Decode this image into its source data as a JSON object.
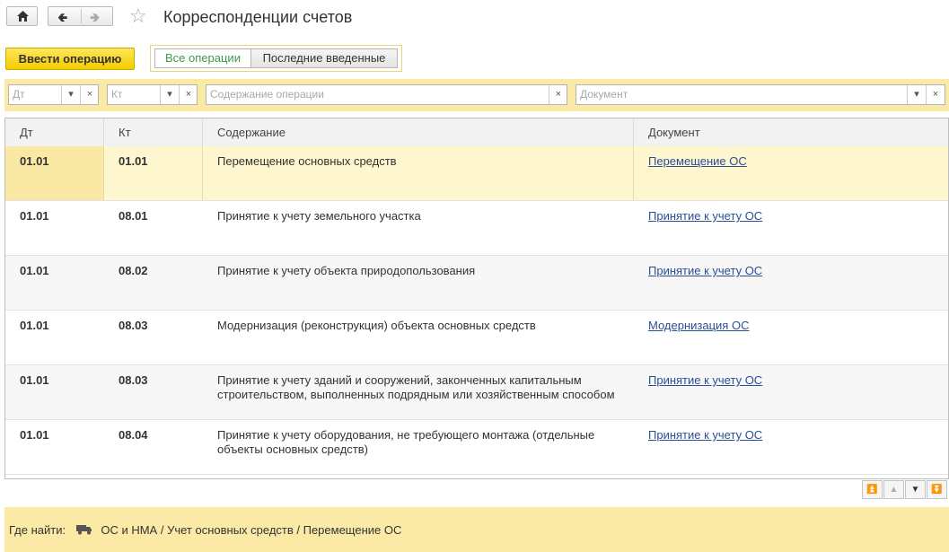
{
  "title": "Корреспонденции счетов",
  "actions": {
    "enter_operation": "Ввести операцию",
    "toggle_all": "Все операции",
    "toggle_recent": "Последние введенные"
  },
  "filters": {
    "dt_placeholder": "Дт",
    "kt_placeholder": "Кт",
    "content_placeholder": "Содержание операции",
    "document_placeholder": "Документ"
  },
  "table": {
    "headers": [
      "Дт",
      "Кт",
      "Содержание",
      "Документ"
    ],
    "rows": [
      {
        "dt": "01.01",
        "kt": "01.01",
        "content": "Перемещение основных средств",
        "content2": "",
        "document": "Перемещение ОС"
      },
      {
        "dt": "01.01",
        "kt": "08.01",
        "content": "Принятие к учету земельного участка",
        "content2": "",
        "document": "Принятие к учету ОС"
      },
      {
        "dt": "01.01",
        "kt": "08.02",
        "content": "Принятие к учету объекта природопользования",
        "content2": "",
        "document": "Принятие к учету ОС"
      },
      {
        "dt": "01.01",
        "kt": "08.03",
        "content": "Модернизация (реконструкция) объекта основных средств",
        "content2": "",
        "document": "Модернизация ОС"
      },
      {
        "dt": "01.01",
        "kt": "08.03",
        "content": "Принятие к учету зданий и сооружений, законченных капитальным",
        "content2": "строительством, выполненных подрядным или хозяйственным способом",
        "document": "Принятие к учету ОС"
      },
      {
        "dt": "01.01",
        "kt": "08.04",
        "content": "Принятие к учету оборудования, не требующего монтажа (отдельные",
        "content2": "объекты основных средств)",
        "document": "Принятие к учету ОС"
      }
    ]
  },
  "footer": {
    "where_label": "Где найти:",
    "path": "ОС и НМА / Учет основных средств / Перемещение ОС"
  }
}
